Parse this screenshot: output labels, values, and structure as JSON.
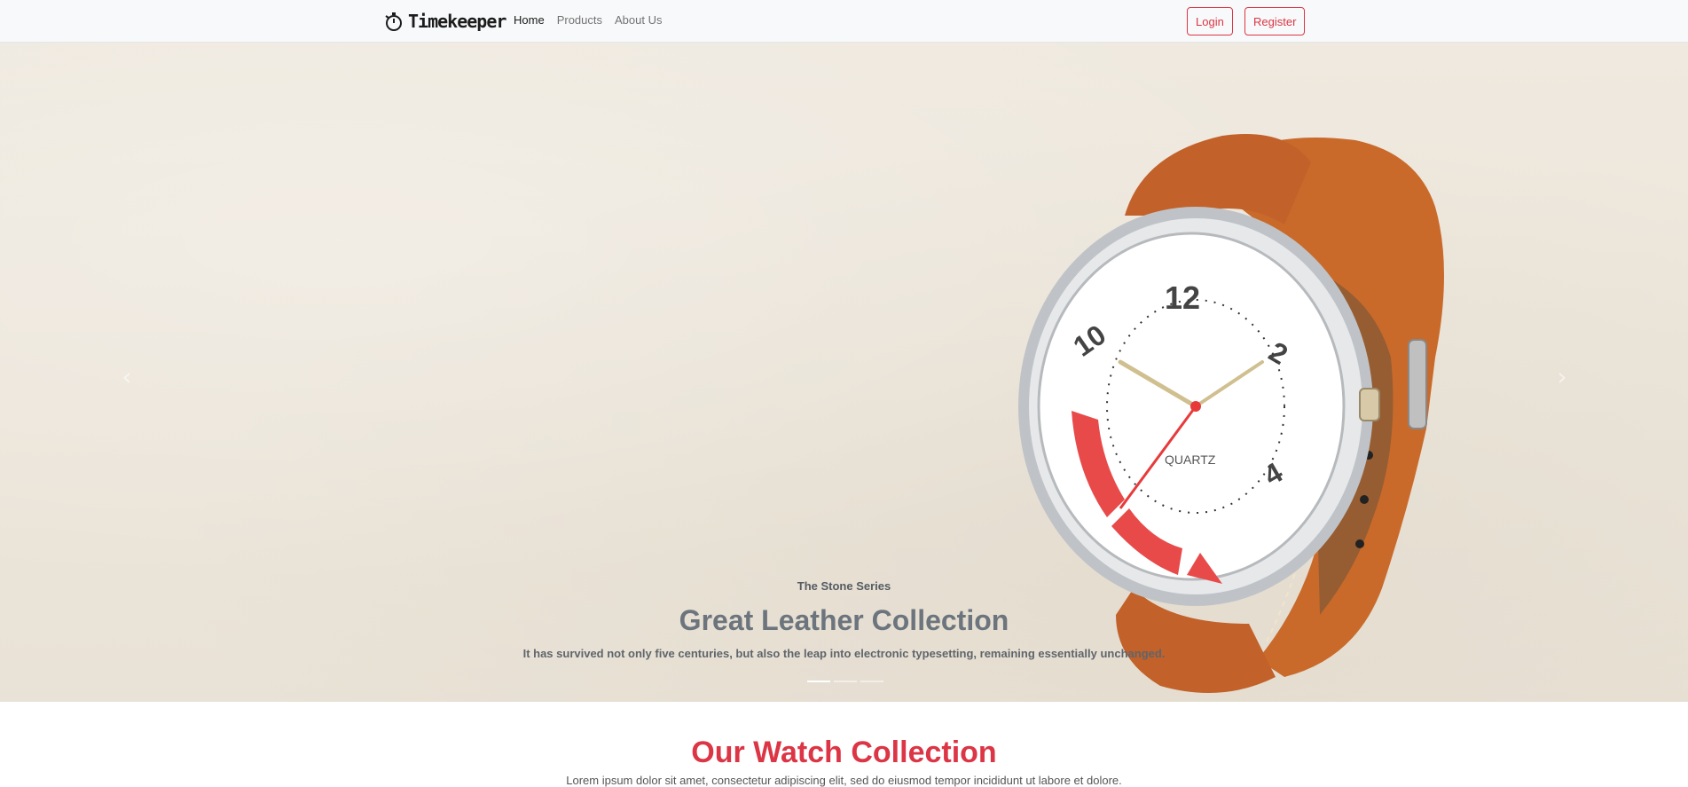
{
  "nav": {
    "brand": "Timekeeper",
    "links": [
      {
        "label": "Home",
        "active": true
      },
      {
        "label": "Products",
        "active": false
      },
      {
        "label": "About Us",
        "active": false
      }
    ],
    "login_label": "Login",
    "register_label": "Register"
  },
  "hero": {
    "series": "The Stone Series",
    "title": "Great Leather Collection",
    "subtitle": "It has survived not only five centuries, but also the leap into electronic typesetting, remaining essentially unchanged.",
    "prev_icon": "chevron-left-icon",
    "next_icon": "chevron-right-icon",
    "slide_count": 3,
    "active_slide": 1,
    "watch_label": "QUARTZ"
  },
  "collection": {
    "title": "Our Watch Collection",
    "subtitle": "Lorem ipsum dolor sit amet, consectetur adipiscing elit, sed do eiusmod tempor incididunt ut labore et dolore."
  },
  "colors": {
    "accent": "#dc3545",
    "nav_bg": "#f8f9fa",
    "hero_bg": "#ece6db"
  }
}
